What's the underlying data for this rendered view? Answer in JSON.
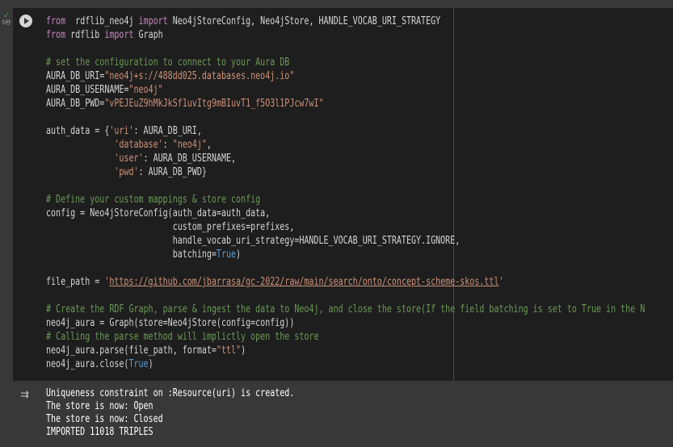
{
  "cell": {
    "status_time": "5秒",
    "code_lines": [
      {
        "parts": [
          [
            "kw",
            "from"
          ],
          [
            "",
            "  rdflib_neo4j "
          ],
          [
            "kw",
            "import"
          ],
          [
            "",
            " Neo4jStoreConfig, Neo4jStore, HANDLE_VOCAB_URI_STRATEGY"
          ]
        ]
      },
      {
        "parts": [
          [
            "kw",
            "from"
          ],
          [
            "",
            " rdflib "
          ],
          [
            "kw",
            "import"
          ],
          [
            "",
            " Graph"
          ]
        ]
      },
      {
        "parts": []
      },
      {
        "parts": [
          [
            "com",
            "# set the configuration to connect to your Aura DB"
          ]
        ]
      },
      {
        "parts": [
          [
            "",
            "AURA_DB_URI="
          ],
          [
            "str",
            "\"neo4j+s://488dd025.databases.neo4j.io\""
          ]
        ]
      },
      {
        "parts": [
          [
            "",
            "AURA_DB_USERNAME="
          ],
          [
            "str",
            "\"neo4j\""
          ]
        ]
      },
      {
        "parts": [
          [
            "",
            "AURA_DB_PWD="
          ],
          [
            "str",
            "\"vPEJEuZ9hMkJkSf1uvItg9mBIuvT1_f5O3l1PJcw7wI\""
          ]
        ]
      },
      {
        "parts": []
      },
      {
        "parts": [
          [
            "",
            "auth_data = {"
          ],
          [
            "str",
            "'uri'"
          ],
          [
            "",
            ": AURA_DB_URI,"
          ]
        ]
      },
      {
        "parts": [
          [
            "",
            "              "
          ],
          [
            "str",
            "'database'"
          ],
          [
            "",
            ": "
          ],
          [
            "str",
            "\"neo4j\""
          ],
          [
            "",
            ","
          ]
        ]
      },
      {
        "parts": [
          [
            "",
            "              "
          ],
          [
            "str",
            "'user'"
          ],
          [
            "",
            ": AURA_DB_USERNAME,"
          ]
        ]
      },
      {
        "parts": [
          [
            "",
            "              "
          ],
          [
            "str",
            "'pwd'"
          ],
          [
            "",
            ": AURA_DB_PWD}"
          ]
        ]
      },
      {
        "parts": []
      },
      {
        "parts": [
          [
            "com",
            "# Define your custom mappings & store config"
          ]
        ]
      },
      {
        "parts": [
          [
            "",
            "config = Neo4jStoreConfig(auth_data=auth_data,"
          ]
        ]
      },
      {
        "parts": [
          [
            "",
            "                          custom_prefixes=prefixes,"
          ]
        ]
      },
      {
        "parts": [
          [
            "",
            "                          handle_vocab_uri_strategy=HANDLE_VOCAB_URI_STRATEGY.IGNORE,"
          ]
        ]
      },
      {
        "parts": [
          [
            "",
            "                          batching="
          ],
          [
            "bool",
            "True"
          ],
          [
            "",
            ")"
          ]
        ]
      },
      {
        "parts": []
      },
      {
        "parts": [
          [
            "",
            "file_path = "
          ],
          [
            "str",
            "'"
          ],
          [
            "url",
            "https://github.com/jbarrasa/gc-2022/raw/main/search/onto/concept-scheme-skos.ttl"
          ],
          [
            "str",
            "'"
          ]
        ]
      },
      {
        "parts": []
      },
      {
        "parts": [
          [
            "com",
            "# Create the RDF Graph, parse & ingest the data to Neo4j, and close the store(If the field batching is set to True in the N"
          ]
        ]
      },
      {
        "parts": [
          [
            "",
            "neo4j_aura = Graph(store=Neo4jStore(config=config))"
          ]
        ]
      },
      {
        "parts": [
          [
            "com",
            "# Calling the parse method will implictly open the store"
          ]
        ]
      },
      {
        "parts": [
          [
            "",
            "neo4j_aura.parse(file_path, format="
          ],
          [
            "str",
            "\"ttl\""
          ],
          [
            "",
            ")"
          ]
        ]
      },
      {
        "parts": [
          [
            "",
            "neo4j_aura.close("
          ],
          [
            "bool",
            "True"
          ],
          [
            "",
            ")"
          ]
        ]
      }
    ]
  },
  "output": {
    "lines": [
      "Uniqueness constraint on :Resource(uri) is created.",
      "The store is now: Open",
      "The store is now: Closed",
      "IMPORTED 11018 TRIPLES"
    ]
  }
}
